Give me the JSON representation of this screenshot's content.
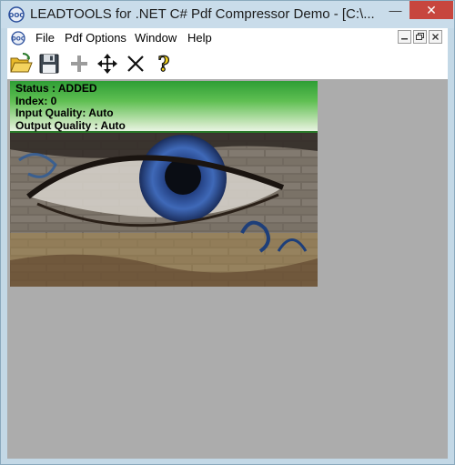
{
  "window": {
    "title": "LEADTOOLS for .NET C# Pdf Compressor Demo - [C:\\...",
    "minimize_glyph": "—",
    "close_glyph": "✕"
  },
  "menu": {
    "items": [
      {
        "label": "File"
      },
      {
        "label": "Pdf Options"
      },
      {
        "label": "Window"
      },
      {
        "label": "Help"
      }
    ]
  },
  "toolbar": {
    "tools": [
      {
        "icon": "open-folder-icon"
      },
      {
        "icon": "save-icon"
      },
      {
        "icon": "add-icon",
        "disabled": true
      },
      {
        "icon": "move-icon"
      },
      {
        "icon": "delete-icon"
      },
      {
        "icon": "help-icon"
      }
    ]
  },
  "document": {
    "status_line": "Status : ADDED",
    "index_line": "Index: 0",
    "input_quality_line": "Input Quality: Auto",
    "output_quality_line": "Output Quality : Auto"
  },
  "colors": {
    "titlebar": "#c9dcea",
    "close_button": "#c7463e",
    "workspace": "#acacac",
    "info_panel_green": "#2e9e35"
  }
}
